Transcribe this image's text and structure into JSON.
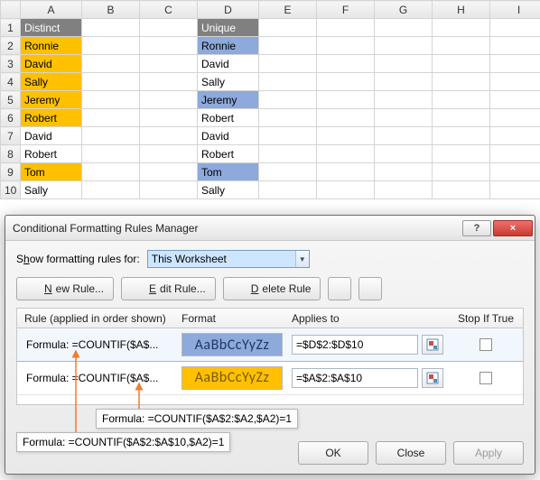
{
  "sheet": {
    "columns": [
      "A",
      "B",
      "C",
      "D",
      "E",
      "F",
      "G",
      "H",
      "I"
    ],
    "row_numbers": [
      "1",
      "2",
      "3",
      "4",
      "5",
      "6",
      "7",
      "8",
      "9",
      "10"
    ],
    "header_a": "Distinct",
    "header_d": "Unique",
    "colA": [
      "Ronnie",
      "David",
      "Sally",
      "Jeremy",
      "Robert",
      "David",
      "Robert",
      "Tom",
      "Sally"
    ],
    "colD": [
      "Ronnie",
      "David",
      "Sally",
      "Jeremy",
      "Robert",
      "David",
      "Robert",
      "Tom",
      "Sally"
    ],
    "hl_a_rows": [
      2,
      3,
      4,
      5,
      6,
      9
    ],
    "hl_d_rows": [
      2,
      5,
      9
    ]
  },
  "dialog": {
    "title": "Conditional Formatting Rules Manager",
    "show_label_pre": "S",
    "show_label_u": "h",
    "show_label_post": "ow formatting rules for:",
    "show_value": "This Worksheet",
    "btn_new": "New Rule...",
    "btn_edit": "Edit Rule...",
    "btn_delete": "Delete Rule",
    "hdr_rule": "Rule (applied in order shown)",
    "hdr_format": "Format",
    "hdr_applies": "Applies to",
    "hdr_stop": "Stop If True",
    "rules": [
      {
        "label": "Formula: =COUNTIF($A$...",
        "preview": "AaBbCcYyZz",
        "applies": "=$D$2:$D$10",
        "style": "blue"
      },
      {
        "label": "Formula: =COUNTIF($A$...",
        "preview": "AaBbCcYyZz",
        "applies": "=$A$2:$A$10",
        "style": "yellow"
      }
    ],
    "tooltip1": "Formula: =COUNTIF($A$2:$A2,$A2)=1",
    "tooltip2": "Formula: =COUNTIF($A$2:$A$10,$A2)=1",
    "ok": "OK",
    "close": "Close",
    "apply": "Apply",
    "help": "?",
    "closeX": "×",
    "arrow_up": "▲",
    "arrow_down": "▼",
    "dd": "▼"
  },
  "icons": {
    "new": "✳",
    "edit": "✎",
    "delete": "✖",
    "ref": "▦"
  }
}
